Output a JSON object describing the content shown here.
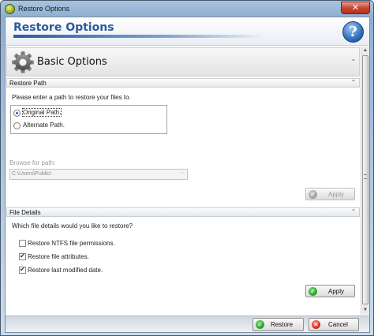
{
  "window": {
    "title": "Restore Options",
    "close_glyph": "✕"
  },
  "header": {
    "title": "Restore Options",
    "help_glyph": "?"
  },
  "basic_options": {
    "title": "Basic Options",
    "collapse_glyph": "⌃"
  },
  "restore_path": {
    "title": "Restore Path",
    "instruction": "Please enter a path to restore your files to.",
    "options": [
      {
        "label": "Original Path.",
        "selected": true
      },
      {
        "label": "Alternate Path.",
        "selected": false
      }
    ],
    "browse_label": "Browse for path:",
    "path_value": "C:\\Users\\Public\\",
    "browse_glyph": "···",
    "apply_label": "Apply"
  },
  "file_details": {
    "title": "File Details",
    "question": "Which file details would you like to restore?",
    "options": [
      {
        "label": "Restore NTFS file permissions.",
        "checked": false
      },
      {
        "label": "Restore file attributes.",
        "checked": true
      },
      {
        "label": "Restore last modified date.",
        "checked": true
      }
    ],
    "apply_label": "Apply"
  },
  "footer": {
    "restore_label": "Restore",
    "cancel_label": "Cancel"
  },
  "icons": {
    "ok": "check-icon",
    "cancel": "x-icon",
    "gear": "gear-icon",
    "help": "help-icon"
  },
  "colors": {
    "accent": "#2c5b9d",
    "ok_green": "#239a23",
    "cancel_red": "#cc2211"
  }
}
